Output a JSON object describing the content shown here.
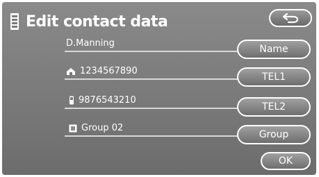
{
  "header": {
    "title": "Edit contact data",
    "back_icon": "return-arrow-icon",
    "title_icon": "phone-book-icon"
  },
  "rows": [
    {
      "value": "D.Manning",
      "icon": "",
      "button": "Name"
    },
    {
      "value": "1234567890",
      "icon": "home-phone-icon",
      "button": "TEL1"
    },
    {
      "value": "9876543210",
      "icon": "mobile-phone-icon",
      "button": "TEL2"
    },
    {
      "value": "Group 02",
      "icon": "group-icon",
      "button": "Group"
    }
  ],
  "footer": {
    "ok_label": "OK"
  }
}
